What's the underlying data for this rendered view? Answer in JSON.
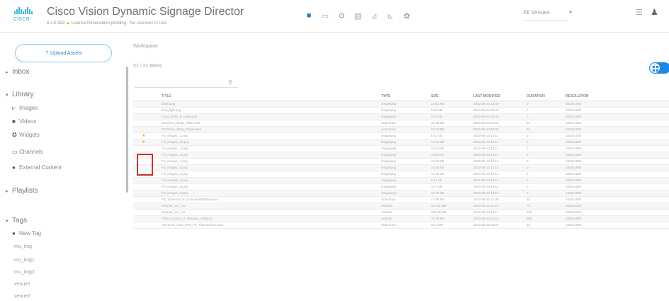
{
  "header": {
    "logo_text": "cisco",
    "app_title": "Cisco Vision Dynamic Signage Director",
    "version": "6.3.0-832",
    "license_warning": "License Reservation pending - No Licenses in Use",
    "toolbar_icons": [
      "folder-icon",
      "monitor-icon",
      "gear-icon",
      "table-icon",
      "chart-icon",
      "signal-icon",
      "settings-icon"
    ],
    "venue_select": "All Venues",
    "right_icons": [
      "menu-icon",
      "user-icon"
    ],
    "accent_color": "#1f7fc2"
  },
  "sidebar": {
    "upload_button": "Upload Assets",
    "sections": {
      "inbox": "Inbox",
      "library": "Library",
      "playlists": "Playlists",
      "tags": "Tags"
    },
    "library_items": [
      {
        "label": "Images",
        "icon": "images-icon"
      },
      {
        "label": "Videos",
        "icon": "video-icon"
      },
      {
        "label": "Widgets",
        "icon": "widget-icon"
      },
      {
        "label": "Channels",
        "icon": "channels-icon"
      },
      {
        "label": "External Content",
        "icon": "external-icon"
      }
    ],
    "new_tag": "New Tag",
    "tags": [
      "mu_img",
      "mu_img1",
      "mu_img2",
      "venue1",
      "venue2"
    ]
  },
  "main": {
    "workspace": "Workspace",
    "items_count": "21 / 21 Items",
    "search_placeholder": "",
    "columns": {
      "title": "TITLE",
      "type": "TYPE",
      "size": "SIZE",
      "modified": "LAST MODIFIED",
      "duration": "DURATION",
      "resolution": "RESOLUTION"
    },
    "rows": [
      {
        "title": "black.png",
        "type": "image/png",
        "size": "13.02 KB",
        "modified": "2020-06-24 12:59",
        "duration": "0",
        "resolution": "1920x1080",
        "starred": false
      },
      {
        "title": "Bud_light.png",
        "type": "image/png",
        "size": "3.86 KB",
        "modified": "2020-06-24 04:43",
        "duration": "0",
        "resolution": "1920x1080",
        "starred": false
      },
      {
        "title": "Coco_Drink_b Large.png",
        "type": "image/png",
        "size": "3.78 KB",
        "modified": "2020-06-24 04:43",
        "duration": "0",
        "resolution": "1920x1080",
        "starred": false
      },
      {
        "title": "DCDemo_Wrap_Miller.mp4",
        "type": "video/mp4",
        "size": "18.48 MB",
        "modified": "2020-06-24 04:51",
        "duration": "15",
        "resolution": "1920x1080",
        "starred": false
      },
      {
        "title": "DCDemo_Wrap_Pepsi.mp4",
        "type": "video/mp4",
        "size": "20.33 MB",
        "modified": "2020-06-24 05:00",
        "duration": "15",
        "resolution": "1920x1080",
        "starred": false
      },
      {
        "title": "FS_image1_1.png",
        "type": "image/png",
        "size": "8.92 KB",
        "modified": "2020-05-13 13:12",
        "duration": "0",
        "resolution": "1920x1080",
        "starred": true
      },
      {
        "title": "FS_image1_10.png",
        "type": "image/png",
        "size": "14.13 KB",
        "modified": "2020-05-13 13:12",
        "duration": "0",
        "resolution": "1920x1080",
        "starred": true
      },
      {
        "title": "FS_image1_2.png",
        "type": "image/png",
        "size": "11.53 KB",
        "modified": "2020-05-13 13:12",
        "duration": "0",
        "resolution": "1920x1080",
        "starred": false
      },
      {
        "title": "FS_image1_3.png",
        "type": "image/png",
        "size": "11.88 KB",
        "modified": "2020-05-13 13:12",
        "duration": "0",
        "resolution": "1920x1080",
        "starred": false
      },
      {
        "title": "FS_image1_4.png",
        "type": "image/png",
        "size": "10.84 KB",
        "modified": "2020-05-13 13:12",
        "duration": "0",
        "resolution": "1920x1080",
        "starred": false
      },
      {
        "title": "FS_image1_5.png",
        "type": "image/png",
        "size": "10.35 KB",
        "modified": "2020-05-13 13:12",
        "duration": "0",
        "resolution": "1920x1080",
        "starred": false
      },
      {
        "title": "FS_image1_6.png",
        "type": "image/png",
        "size": "10.49 KB",
        "modified": "2020-05-13 13:12",
        "duration": "0",
        "resolution": "1920x1080",
        "starred": false
      },
      {
        "title": "FS_image1_7.png",
        "type": "image/png",
        "size": "8.33 KB",
        "modified": "2020-05-13 13:12",
        "duration": "0",
        "resolution": "1920x1080",
        "starred": false
      },
      {
        "title": "FS_image1_8.png",
        "type": "image/png",
        "size": "12.7 KB",
        "modified": "2020-05-13 13:12",
        "duration": "0",
        "resolution": "1920x1080",
        "starred": false
      },
      {
        "title": "FS_image1_9.png",
        "type": "image/png",
        "size": "12.76 KB",
        "modified": "2020-05-13 13:12",
        "duration": "0",
        "resolution": "1920x1080",
        "starred": false
      },
      {
        "title": "FS_TimeHorizon_ConcentrBitRate.mp4",
        "type": "video/mp4",
        "size": "17.08 MB",
        "modified": "2020-06-25 01:30",
        "duration": "15",
        "resolution": "1920x1080",
        "starred": false
      },
      {
        "title": "Regular_4K_1.ts",
        "type": "video/ts",
        "size": "237.61 MB",
        "modified": "2020-05-13 12:15",
        "duration": "76",
        "resolution": "3840x2160",
        "starred": false
      },
      {
        "title": "Regular_4K_2.ts",
        "type": "video/ts",
        "size": "318.42 MB",
        "modified": "2020-05-13 13:17",
        "duration": "103",
        "resolution": "3840x2160",
        "starred": false
      },
      {
        "title": "Time_Counter_5_Minutes_1080p.ts",
        "type": "video/ts",
        "size": "70.76 MB",
        "modified": "2020-05-13 12:19",
        "duration": "309",
        "resolution": "1920x1080",
        "starred": false
      },
      {
        "title": "UPLOAD_CVD_Test_FS_TimeHorizon.mp4",
        "type": "video/mp4",
        "size": "20.1 MB",
        "modified": "2020-06-25 02:01",
        "duration": "15",
        "resolution": "1920x1080",
        "starred": false
      }
    ]
  }
}
